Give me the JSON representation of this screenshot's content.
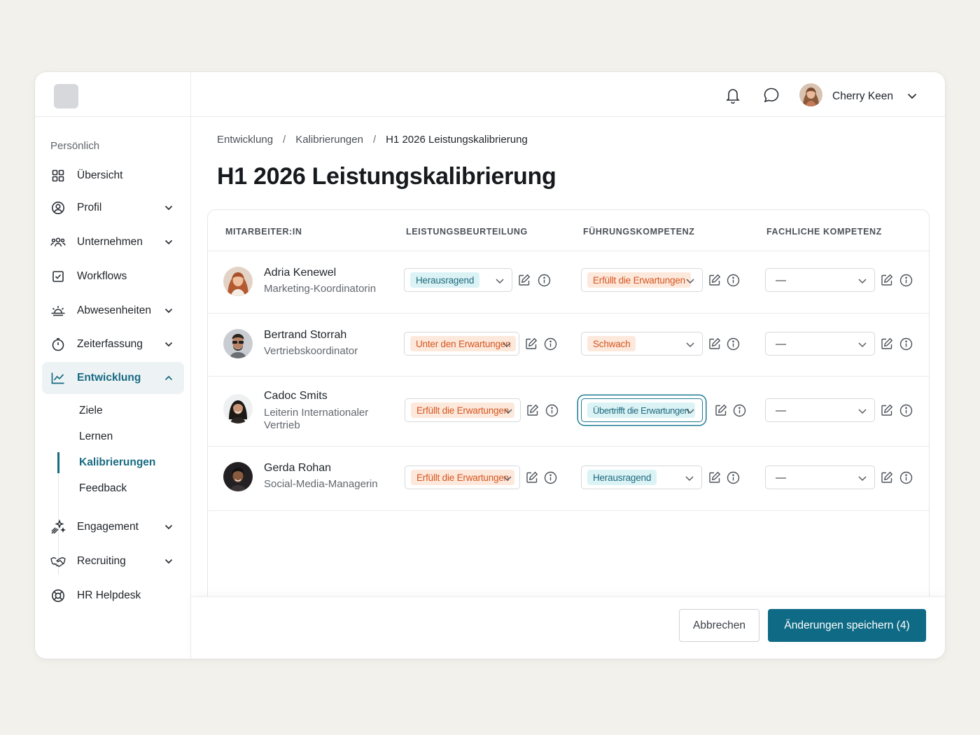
{
  "colors": {
    "accent": "#186a82",
    "primary_button": "#0f6b85",
    "badge_teal_bg": "#dcf3f6",
    "badge_teal_text": "#1e6a7d",
    "badge_orange_bg": "#fde8dc",
    "badge_orange_text": "#d4561f"
  },
  "sidebar": {
    "section_label": "Persönlich",
    "items": [
      {
        "label": "Übersicht",
        "icon": "grid-icon",
        "has_chevron": false
      },
      {
        "label": "Profil",
        "icon": "user-circle-icon",
        "has_chevron": true
      },
      {
        "label": "Unternehmen",
        "icon": "people-icon",
        "has_chevron": true
      },
      {
        "label": "Workflows",
        "icon": "checkbox-icon",
        "has_chevron": true
      },
      {
        "label": "Abwesenheiten",
        "icon": "sunrise-icon",
        "has_chevron": true
      },
      {
        "label": "Zeiterfassung",
        "icon": "stopwatch-icon",
        "has_chevron": true
      },
      {
        "label": "Entwicklung",
        "icon": "chart-line-icon",
        "has_chevron": true,
        "active": true
      },
      {
        "label": "Engagement",
        "icon": "sparkle-icon",
        "has_chevron": true
      },
      {
        "label": "Recruiting",
        "icon": "handshake-icon",
        "has_chevron": true
      },
      {
        "label": "HR Helpdesk",
        "icon": "lifebuoy-icon",
        "has_chevron": false
      }
    ],
    "subitems": [
      {
        "label": "Ziele"
      },
      {
        "label": "Lernen"
      },
      {
        "label": "Kalibrierungen",
        "active": true
      },
      {
        "label": "Feedback"
      }
    ]
  },
  "header": {
    "user_name": "Cherry Keen",
    "icons": [
      "bell-icon",
      "chat-icon",
      "chevron-down-icon"
    ]
  },
  "breadcrumb": {
    "items": [
      "Entwicklung",
      "Kalibrierungen",
      "H1 2026 Leistungskalibrierung"
    ],
    "separator": "/"
  },
  "page_title": "H1 2026 Leistungskalibrierung",
  "table": {
    "columns": [
      "MITARBEITER:IN",
      "LEISTUNGSBEURTEILUNG",
      "FÜHRUNGSKOMPETENZ",
      "FACHLICHE KOMPETENZ"
    ],
    "rows": [
      {
        "name": "Adria Kenewel",
        "role": "Marketing-Koordinatorin",
        "leistung": {
          "value": "Herausragend",
          "tone": "teal"
        },
        "fuehrung": {
          "value": "Erfüllt die Erwartungen",
          "tone": "orange"
        },
        "fachlich": {
          "value": "—"
        }
      },
      {
        "name": "Bertrand Storrah",
        "role": "Vertriebskoordinator",
        "leistung": {
          "value": "Unter den Erwartungen",
          "tone": "orange"
        },
        "fuehrung": {
          "value": "Schwach",
          "tone": "orange"
        },
        "fachlich": {
          "value": "—"
        }
      },
      {
        "name": "Cadoc Smits",
        "role": "Leiterin Internationaler Vertrieb",
        "leistung": {
          "value": "Erfüllt die Erwartungen",
          "tone": "orange"
        },
        "fuehrung": {
          "value": "Übertrifft die Erwartungen",
          "tone": "teal",
          "focused": true
        },
        "fachlich": {
          "value": "—"
        }
      },
      {
        "name": "Gerda Rohan",
        "role": "Social-Media-Managerin",
        "leistung": {
          "value": "Erfüllt die Erwartungen",
          "tone": "orange"
        },
        "fuehrung": {
          "value": "Herausragend",
          "tone": "teal"
        },
        "fachlich": {
          "value": "—"
        }
      }
    ]
  },
  "footer": {
    "cancel_label": "Abbrechen",
    "save_label": "Änderungen speichern (4)"
  }
}
